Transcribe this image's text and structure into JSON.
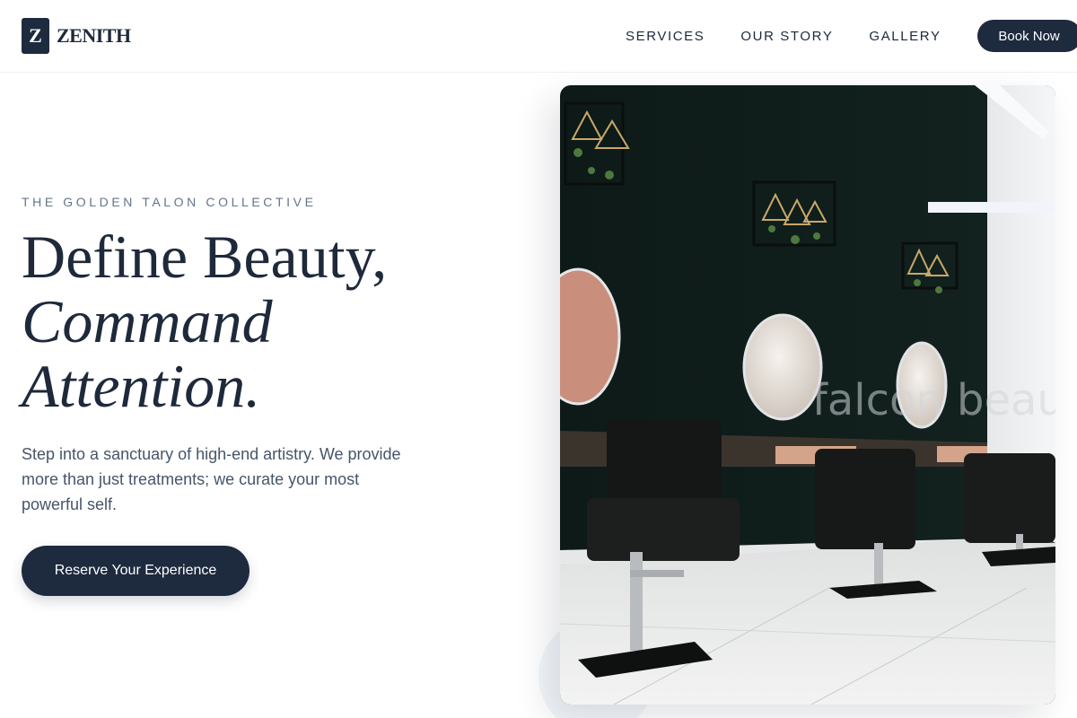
{
  "header": {
    "logo_mark": "Z",
    "logo_text": "ZENITH",
    "nav": [
      {
        "label": "SERVICES"
      },
      {
        "label": "OUR STORY"
      },
      {
        "label": "GALLERY"
      }
    ],
    "book_label": "Book Now"
  },
  "hero": {
    "eyebrow": "THE GOLDEN TALON COLLECTIVE",
    "headline": {
      "line1": "Define Beauty,",
      "line2": "Command",
      "line3": "Attention."
    },
    "description": "Step into a sanctuary of high-end artistry. We provide more than just treatments; we curate your most powerful self.",
    "cta_label": "Reserve Your Experience",
    "image": {
      "icon": "salon-interior-photo",
      "watermark": "falcon beauty"
    }
  },
  "colors": {
    "primary": "#1e2a3e",
    "text": "#1e293b",
    "muted": "#64748b",
    "wall": "#0f1c1a"
  }
}
